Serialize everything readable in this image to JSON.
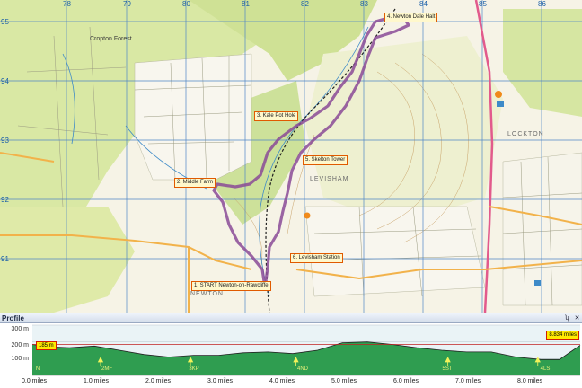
{
  "map": {
    "grid_top": [
      "78",
      "79",
      "80",
      "81",
      "82",
      "83",
      "84",
      "85",
      "86"
    ],
    "grid_left": [
      "95",
      "94",
      "93",
      "92",
      "91"
    ],
    "waypoints": [
      {
        "id": "start",
        "label": "1. START Newton-on-Rawcliffe"
      },
      {
        "id": "middle-farm",
        "label": "2. Middle Farm"
      },
      {
        "id": "kale-pot-hole",
        "label": "3. Kale Pot Hole"
      },
      {
        "id": "newton-dale-halt",
        "label": "4. Newton Dale Halt"
      },
      {
        "id": "skelton-tower",
        "label": "5. Skelton Tower"
      },
      {
        "id": "levisham-station",
        "label": "6. Levisham Station"
      }
    ],
    "places": [
      {
        "id": "cropton-forest",
        "label": "Cropton Forest"
      },
      {
        "id": "levisham",
        "label": "LEVISHAM"
      },
      {
        "id": "lockton",
        "label": "LOCKTON"
      },
      {
        "id": "newton",
        "label": "NEWTON"
      }
    ],
    "colors": {
      "route": "#8a4a96",
      "forest": "#d9e8a4",
      "moor": "#eef0d0",
      "grid": "#4f86c6",
      "road_a": "#e25a8c",
      "road_minor": "#f2b24a",
      "water": "#3d8ac8"
    }
  },
  "profile": {
    "title": "Profile",
    "pin_icon": "pin-icon",
    "close_icon": "close-icon",
    "y_labels": [
      "300 m",
      "200 m",
      "100 m"
    ],
    "x_labels": [
      "0.0 miles",
      "1.0 miles",
      "2.0 miles",
      "3.0 miles",
      "4.0 miles",
      "5.0 miles",
      "6.0 miles",
      "7.0 miles",
      "8.0 miles"
    ],
    "current_elevation": "185 m",
    "total_distance": "8.834 miles",
    "start_code": "N",
    "waypoint_codes": [
      "2MF",
      "3KP",
      "4ND",
      "5ST",
      "4LS"
    ],
    "colors": {
      "fill": "#2f9d50",
      "outline": "#202020",
      "marker": "#f3f35a",
      "crosshair": "#c02020"
    },
    "chart_data": {
      "type": "area",
      "xlabel": "",
      "ylabel": "",
      "x_unit": "miles",
      "y_unit": "m",
      "xlim": [
        0,
        8.834
      ],
      "ylim": [
        0,
        300
      ],
      "x": [
        0,
        0.3,
        0.6,
        1.0,
        1.4,
        1.8,
        2.2,
        2.6,
        3.0,
        3.4,
        3.8,
        4.2,
        4.6,
        5.0,
        5.4,
        5.8,
        6.2,
        6.6,
        7.0,
        7.4,
        7.8,
        8.2,
        8.5,
        8.834
      ],
      "y": [
        185,
        170,
        165,
        175,
        150,
        125,
        110,
        120,
        120,
        135,
        140,
        130,
        150,
        195,
        200,
        185,
        165,
        150,
        140,
        140,
        110,
        95,
        95,
        180
      ],
      "waypoint_x": [
        1.1,
        2.55,
        4.25,
        6.7,
        8.15
      ]
    }
  }
}
